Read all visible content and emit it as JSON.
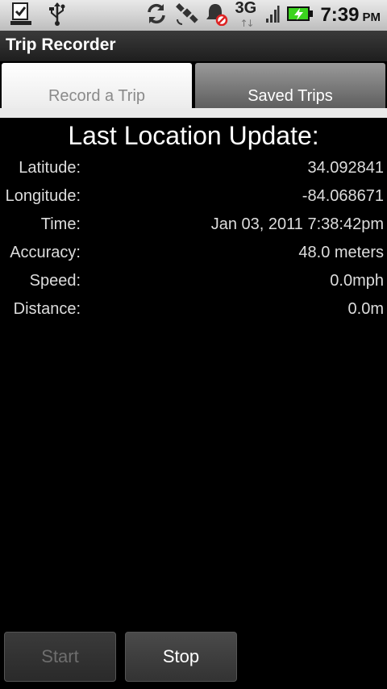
{
  "status_bar": {
    "icons_left": [
      "download-done-icon",
      "usb-icon"
    ],
    "icons_right": [
      "sync-icon",
      "gps-satellite-icon",
      "notifications-muted-icon",
      "signal-icon",
      "battery-charging-icon"
    ],
    "network": "3G",
    "time": "7:39",
    "ampm": "PM",
    "battery_color": "#3bd41e"
  },
  "app": {
    "title": "Trip Recorder"
  },
  "tabs": [
    {
      "label": "Record a Trip",
      "selected": true
    },
    {
      "label": "Saved Trips",
      "selected": false
    }
  ],
  "heading": "Last Location Update:",
  "fields": {
    "latitude": {
      "label": "Latitude:",
      "value": "34.092841"
    },
    "longitude": {
      "label": "Longitude:",
      "value": "-84.068671"
    },
    "time": {
      "label": "Time:",
      "value": "Jan 03, 2011 7:38:42pm"
    },
    "accuracy": {
      "label": "Accuracy:",
      "value": "48.0 meters"
    },
    "speed": {
      "label": "Speed:",
      "value": "0.0mph"
    },
    "distance": {
      "label": "Distance:",
      "value": "0.0m"
    }
  },
  "buttons": {
    "start": "Start",
    "stop": "Stop",
    "start_enabled": false
  }
}
